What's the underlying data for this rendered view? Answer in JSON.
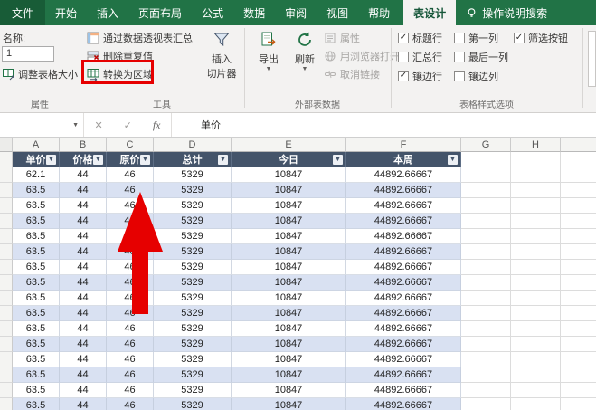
{
  "tabs": {
    "file": "文件",
    "items": [
      "开始",
      "插入",
      "页面布局",
      "公式",
      "数据",
      "审阅",
      "视图",
      "帮助"
    ],
    "active": "表设计",
    "tell_me": "操作说明搜索"
  },
  "ribbon": {
    "properties_group": {
      "name_label": "名称:",
      "name_value": "1",
      "resize_button": "调整表格大小",
      "group_label": "属性"
    },
    "tools_group": {
      "summarize_pivot": "通过数据透视表汇总",
      "remove_duplicates": "删除重复值",
      "convert_to_range": "转换为区域",
      "insert_slicer_line1": "插入",
      "insert_slicer_line2": "切片器",
      "group_label": "工具"
    },
    "external_group": {
      "export_label": "导出",
      "refresh_label": "刷新",
      "properties_label": "属性",
      "open_in_browser_label": "用浏览器打开",
      "unlink_label": "取消链接",
      "group_label": "外部表数据"
    },
    "style_options_group": {
      "options": [
        {
          "label": "标题行",
          "checked": true
        },
        {
          "label": "汇总行",
          "checked": false
        },
        {
          "label": "镶边行",
          "checked": true
        },
        {
          "label": "第一列",
          "checked": false
        },
        {
          "label": "最后一列",
          "checked": false
        },
        {
          "label": "镶边列",
          "checked": false
        },
        {
          "label": "筛选按钮",
          "checked": true
        }
      ],
      "group_label": "表格样式选项"
    }
  },
  "formula_bar": {
    "name_box_value": "",
    "cancel_glyph": "✕",
    "enter_glyph": "✓",
    "fx_glyph": "fx",
    "cell_content": "单价"
  },
  "grid": {
    "column_letters": [
      "A",
      "B",
      "C",
      "D",
      "E",
      "F",
      "G",
      "H"
    ],
    "table_headers": [
      "单价",
      "价格",
      "原价",
      "总计",
      "今日",
      "本周"
    ],
    "rows": [
      [
        "62.1",
        "44",
        "46",
        "5329",
        "10847",
        "44892.66667"
      ],
      [
        "63.5",
        "44",
        "46",
        "5329",
        "10847",
        "44892.66667"
      ],
      [
        "63.5",
        "44",
        "46",
        "5329",
        "10847",
        "44892.66667"
      ],
      [
        "63.5",
        "44",
        "46",
        "5329",
        "10847",
        "44892.66667"
      ],
      [
        "63.5",
        "44",
        "46",
        "5329",
        "10847",
        "44892.66667"
      ],
      [
        "63.5",
        "44",
        "46",
        "5329",
        "10847",
        "44892.66667"
      ],
      [
        "63.5",
        "44",
        "46",
        "5329",
        "10847",
        "44892.66667"
      ],
      [
        "63.5",
        "44",
        "46",
        "5329",
        "10847",
        "44892.66667"
      ],
      [
        "63.5",
        "44",
        "46",
        "5329",
        "10847",
        "44892.66667"
      ],
      [
        "63.5",
        "44",
        "46",
        "5329",
        "10847",
        "44892.66667"
      ],
      [
        "63.5",
        "44",
        "46",
        "5329",
        "10847",
        "44892.66667"
      ],
      [
        "63.5",
        "44",
        "46",
        "5329",
        "10847",
        "44892.66667"
      ],
      [
        "63.5",
        "44",
        "46",
        "5329",
        "10847",
        "44892.66667"
      ],
      [
        "63.5",
        "44",
        "46",
        "5329",
        "10847",
        "44892.66667"
      ],
      [
        "63.5",
        "44",
        "46",
        "5329",
        "10847",
        "44892.66667"
      ],
      [
        "63.5",
        "44",
        "46",
        "5329",
        "10847",
        "44892.66667"
      ]
    ]
  },
  "colors": {
    "excel_green": "#217346",
    "table_header_fill": "#44546a",
    "band_fill": "#d9e1f2",
    "annotation_red": "#e60000"
  }
}
